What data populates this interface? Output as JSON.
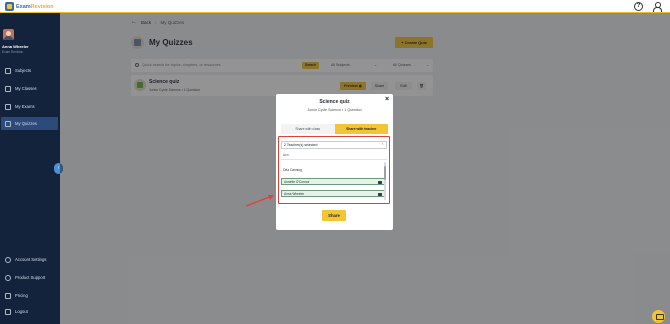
{
  "app": {
    "logo_part1": "Exam",
    "logo_part2": "Revision"
  },
  "header": {
    "help_icon": "help-icon",
    "user_icon": "user-icon"
  },
  "user": {
    "name": "Anna Wheeler",
    "school": "Exam Revision"
  },
  "sidebar": {
    "items": [
      {
        "label": "Subjects",
        "icon": "phone-icon"
      },
      {
        "label": "My Classes",
        "icon": "chat-icon"
      },
      {
        "label": "My Exams",
        "icon": "book-icon"
      },
      {
        "label": "My Quizzes",
        "icon": "quiz-icon"
      },
      {
        "label": "Account Settings",
        "icon": "gear-icon"
      },
      {
        "label": "Product Support",
        "icon": "support-icon"
      },
      {
        "label": "Pricing",
        "icon": "card-icon"
      },
      {
        "label": "Logout",
        "icon": "logout-icon"
      }
    ],
    "active_index": 3
  },
  "main": {
    "back_label": "Back",
    "breadcrumb": "My Quizzes",
    "page_title": "My Quizzes",
    "create_button": "+ Create Quiz",
    "search_placeholder": "Quick search for topics, chapters, or resources",
    "search_button": "Search",
    "filter_subjects": "All Subjects",
    "filter_quizzes": "All Quizzes",
    "quiz": {
      "title": "Science quiz",
      "meta": "Junior Cycle Science • 1 Question",
      "preview": "Preview",
      "share": "Share",
      "edit": "Edit"
    }
  },
  "modal": {
    "title": "Science quiz",
    "subtitle": "Junior Cycle Science • 1 Question",
    "tabs": [
      "Share with class",
      "Share with teacher"
    ],
    "active_tab": 1,
    "dropdown_label": "2 Teacher(s) selected",
    "filter_text": "Ann",
    "options": [
      {
        "label": "Orla Canning",
        "selected": false
      },
      {
        "label": "Annette O'Connor",
        "selected": true
      },
      {
        "label": "Anna Wheeler",
        "selected": true
      }
    ],
    "share_button": "Share",
    "close": "×"
  },
  "colors": {
    "accent": "#f3c433",
    "sidebar": "#13233c",
    "highlight": "#e04136"
  }
}
